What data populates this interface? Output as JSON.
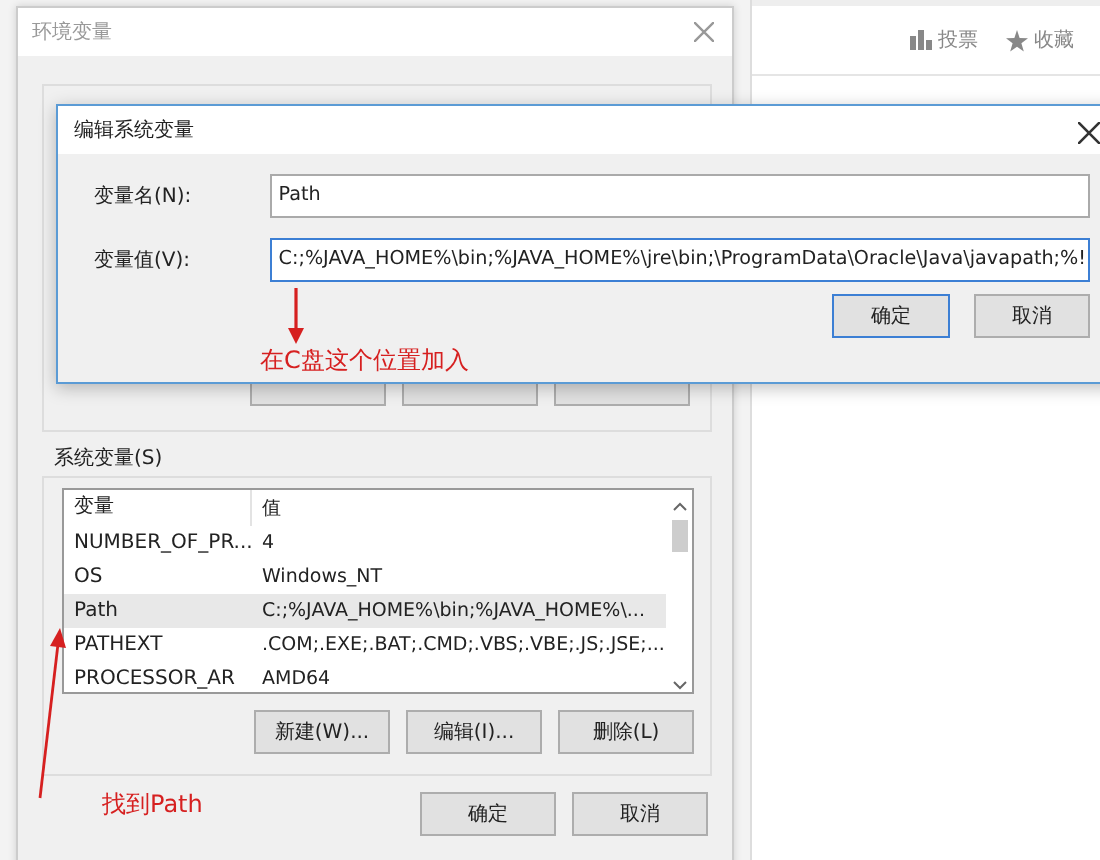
{
  "web_page": {
    "actions": [
      {
        "kind": "vote",
        "label": "投票"
      },
      {
        "kind": "favorite",
        "label": "收藏"
      }
    ]
  },
  "env_window": {
    "title": "环境变量",
    "system_group": {
      "label": "系统变量(S)",
      "columns": [
        "变量",
        "值"
      ],
      "rows": [
        {
          "name": "NUMBER_OF_PR...",
          "value": "4",
          "selected": false
        },
        {
          "name": "OS",
          "value": "Windows_NT",
          "selected": false
        },
        {
          "name": "Path",
          "value": "C:;%JAVA_HOME%\\bin;%JAVA_HOME%\\...",
          "selected": true
        },
        {
          "name": "PATHEXT",
          "value": ".COM;.EXE;.BAT;.CMD;.VBS;.VBE;.JS;.JSE;...",
          "selected": false
        },
        {
          "name": "PROCESSOR_AR",
          "value": "AMD64",
          "selected": false
        }
      ],
      "buttons": [
        "新建(W)...",
        "编辑(I)...",
        "删除(L)"
      ]
    },
    "buttons": [
      "确定",
      "取消"
    ]
  },
  "edit_dialog": {
    "title": "编辑系统变量",
    "fields": [
      {
        "label": "变量名(N):",
        "value": "Path"
      },
      {
        "label": "变量值(V):",
        "value": "C:;%JAVA_HOME%\\bin;%JAVA_HOME%\\jre\\bin;\\ProgramData\\Oracle\\Java\\javapath;%!"
      }
    ],
    "buttons": [
      {
        "label": "确定",
        "default": true
      },
      {
        "label": "取消",
        "default": false
      }
    ]
  },
  "annotations": [
    {
      "text": "在C盘这个位置加入"
    },
    {
      "text": "找到Path"
    }
  ]
}
